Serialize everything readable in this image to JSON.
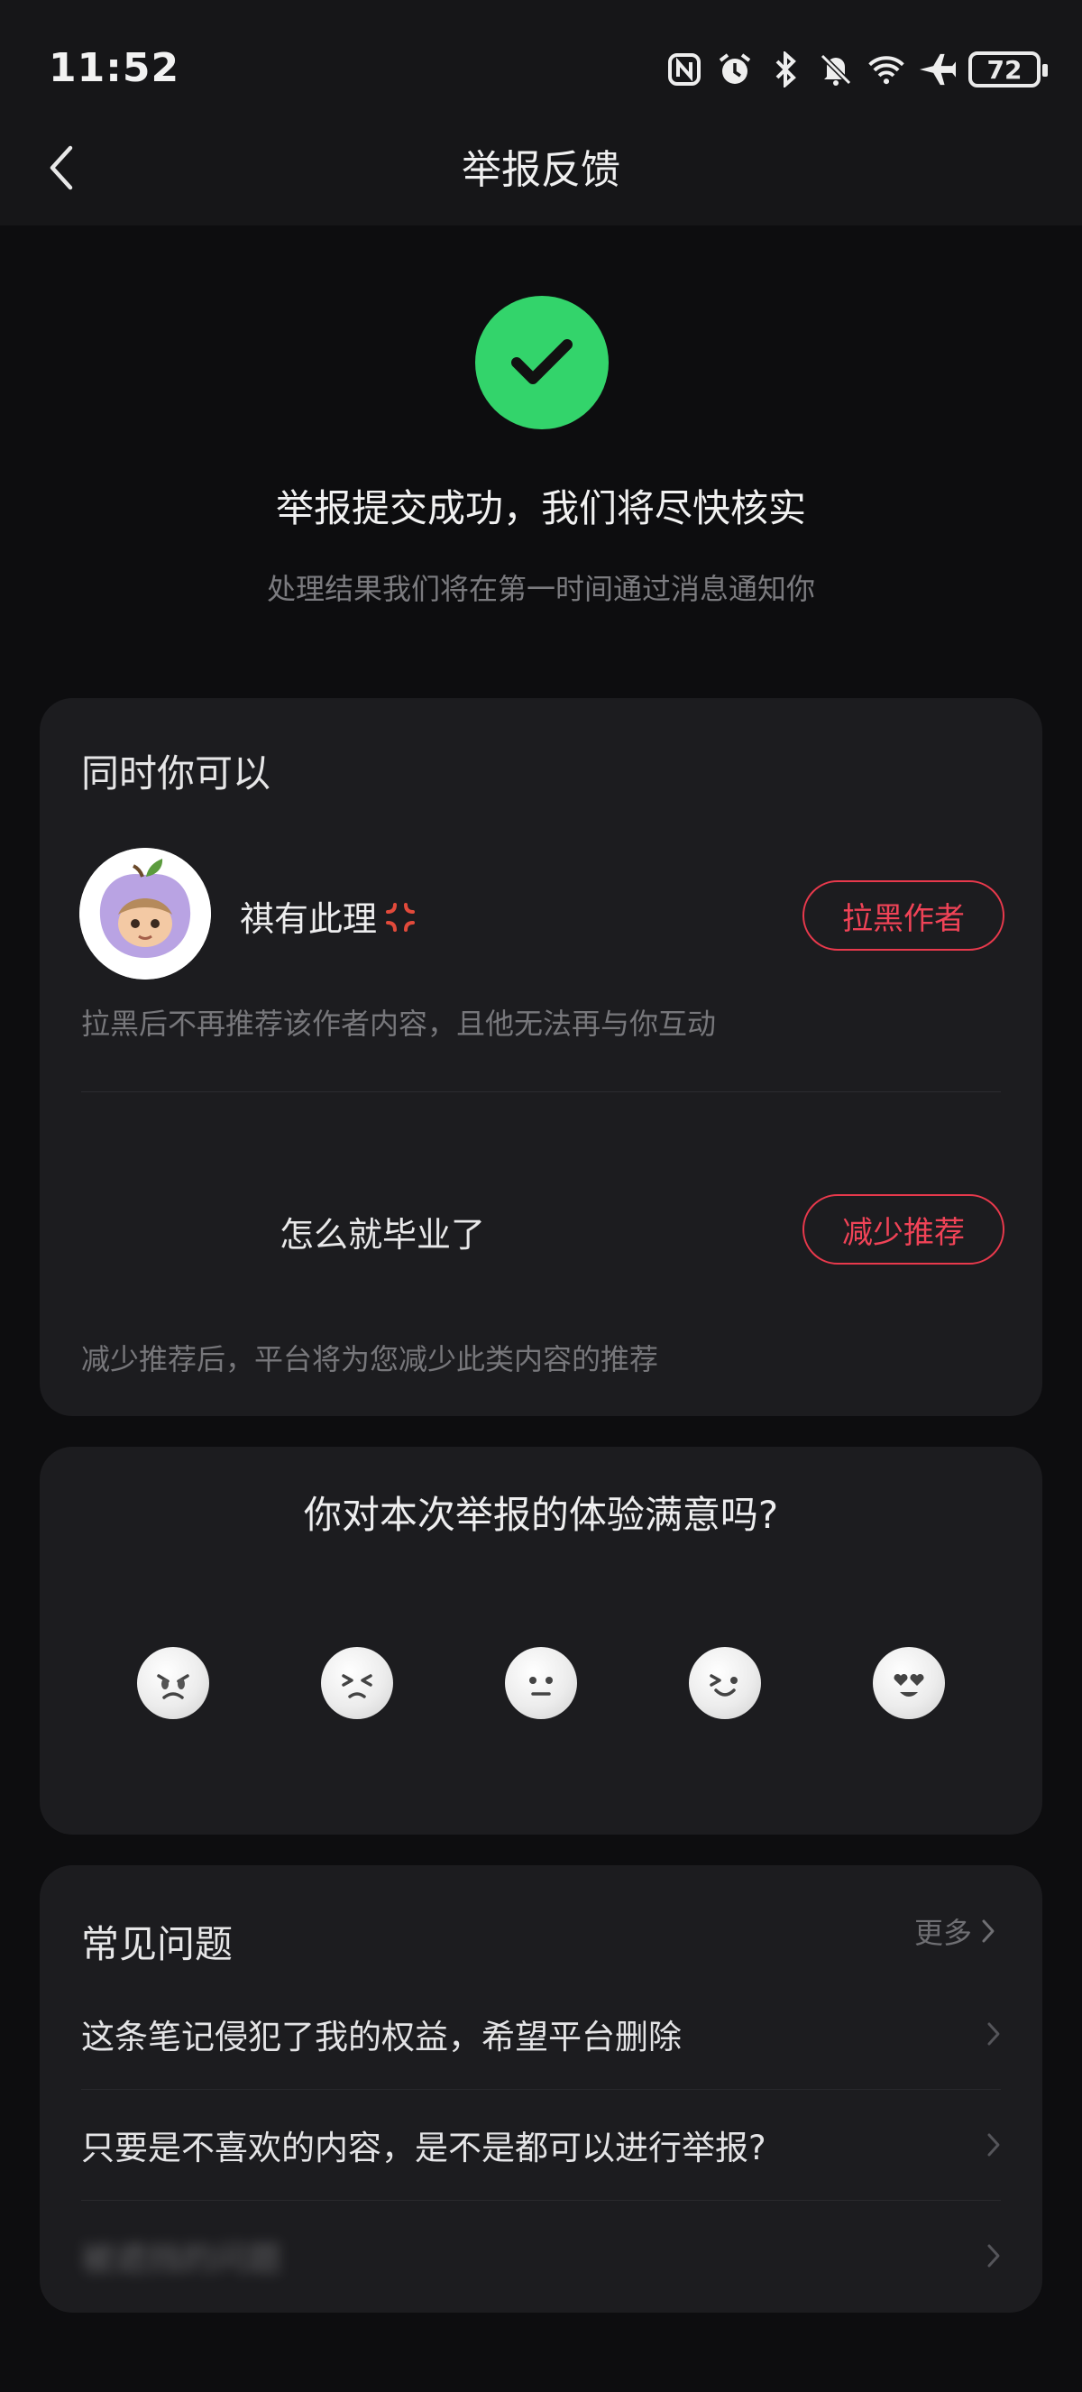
{
  "status_bar": {
    "time": "11:52",
    "battery": "72",
    "icons": [
      "nfc-icon",
      "alarm-icon",
      "bluetooth-icon",
      "mute-icon",
      "wifi-icon",
      "airplane-icon",
      "battery-icon"
    ]
  },
  "header": {
    "title": "举报反馈",
    "back_icon": "chevron-left-icon"
  },
  "success": {
    "icon": "check-circle-icon",
    "color": "#33d46b",
    "title": "举报提交成功，我们将尽快核实",
    "subtitle": "处理结果我们将在第一时间通过消息通知你"
  },
  "actions_card": {
    "heading": "同时你可以",
    "author": {
      "name": "祺有此理",
      "block_button": "拉黑作者",
      "block_desc": "拉黑后不再推荐该作者内容，且他无法再与你互动"
    },
    "note": {
      "title": "怎么就毕业了",
      "reduce_button": "减少推荐",
      "reduce_desc": "减少推荐后，平台将为您减少此类内容的推荐"
    },
    "accent": "#f04357"
  },
  "survey": {
    "question": "你对本次举报的体验满意吗?",
    "faces": [
      "very-angry-face-icon",
      "unhappy-face-icon",
      "neutral-face-icon",
      "smiling-face-icon",
      "heart-eyes-face-icon"
    ]
  },
  "faq": {
    "heading": "常见问题",
    "more": "更多",
    "items": [
      "这条笔记侵犯了我的权益，希望平台删除",
      "只要是不喜欢的内容，是不是都可以进行举报?",
      "被遮挡的问题"
    ]
  }
}
